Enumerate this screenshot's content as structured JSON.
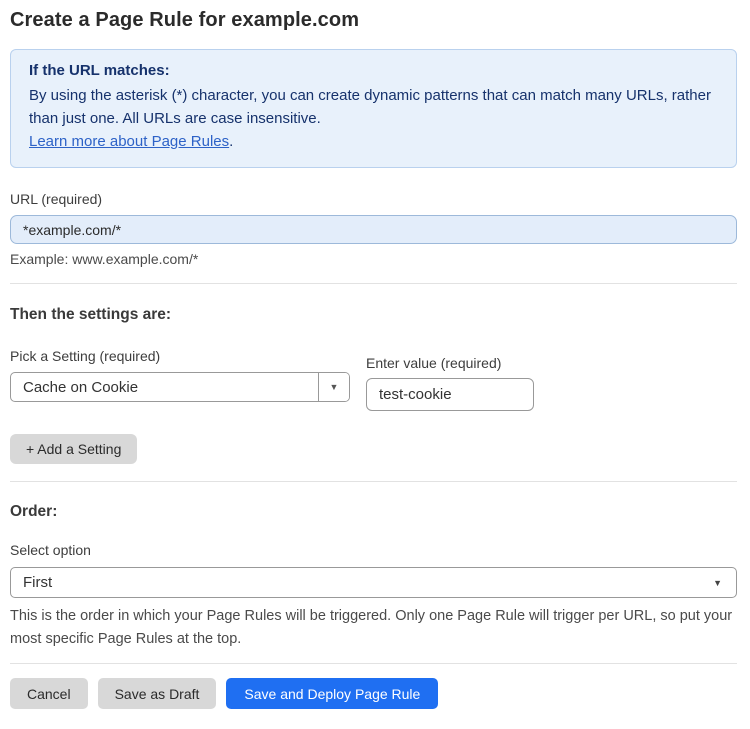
{
  "page": {
    "title": "Create a Page Rule for example.com"
  },
  "callout": {
    "heading": "If the URL matches:",
    "body": "By using the asterisk (*) character, you can create dynamic patterns that can match many URLs, rather than just one. All URLs are case insensitive.",
    "link_label": "Learn more about Page Rules",
    "link_suffix": "."
  },
  "url_field": {
    "label": "URL (required)",
    "value": "*example.com/*",
    "example": "Example: www.example.com/*"
  },
  "settings": {
    "heading": "Then the settings are:",
    "setting_label": "Pick a Setting (required)",
    "setting_value": "Cache on Cookie",
    "dropdown_arrow_icon": "▼",
    "value_label": "Enter value (required)",
    "value_value": "test-cookie",
    "add_button_label": "+ Add a Setting"
  },
  "order": {
    "heading": "Order:",
    "select_label": "Select option",
    "selected_option": "First",
    "select_arrow_icon": "▼",
    "help_text": "This is the order in which your Page Rules will be triggered. Only one Page Rule will trigger per URL, so put your most specific Page Rules at the top."
  },
  "footer": {
    "cancel_label": "Cancel",
    "save_draft_label": "Save as Draft",
    "deploy_label": "Save and Deploy Page Rule"
  },
  "colors": {
    "accent_blue": "#1f6ff2",
    "callout_bg": "#e8f1fb",
    "callout_text": "#16326c",
    "link_blue": "#2d62c7",
    "url_input_bg": "#e3edfa",
    "gray_button": "#d8d8d8"
  }
}
